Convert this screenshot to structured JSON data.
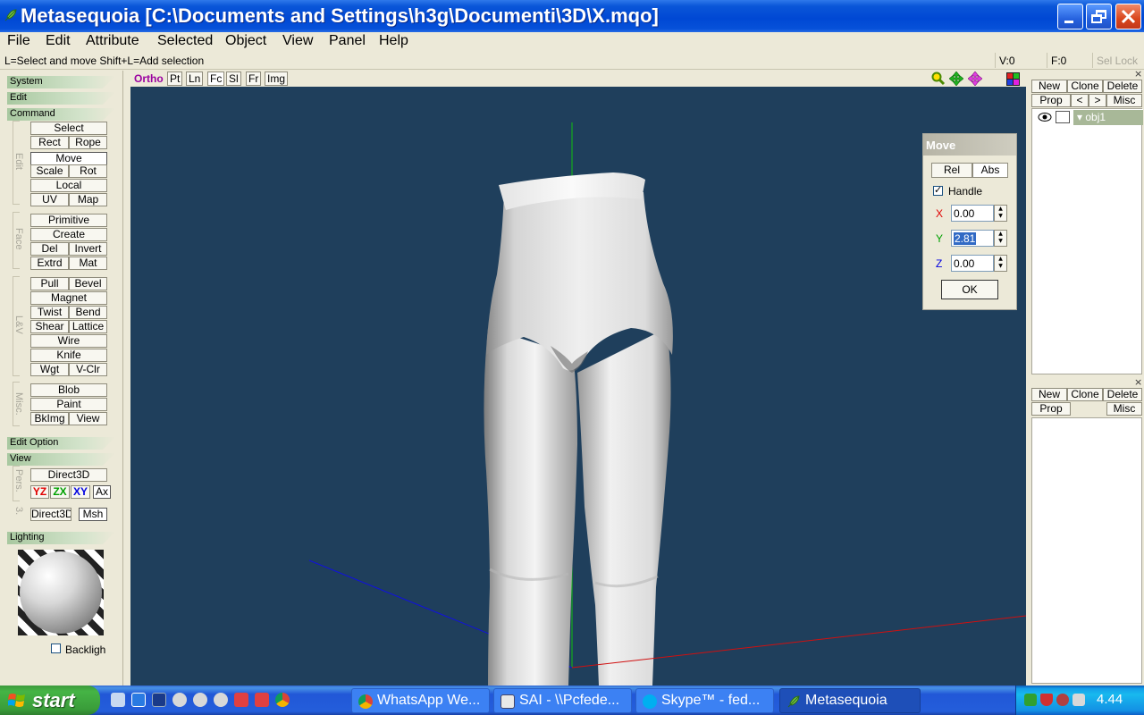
{
  "window": {
    "title": "Metasequoia [C:\\Documents and Settings\\h3g\\Documenti\\3D\\X.mqo]"
  },
  "menu": [
    "File",
    "Edit",
    "Attribute",
    "Selected",
    "Object",
    "View",
    "Panel",
    "Help"
  ],
  "status": {
    "hint": "L=Select and move  Shift+L=Add selection",
    "vertices": "V:0",
    "faces": "F:0",
    "sel_lock": "Sel Lock"
  },
  "left_panel": {
    "sections": [
      "System",
      "Edit",
      "Command",
      "Edit Option",
      "View",
      "Lighting"
    ],
    "group_labels": [
      "Edit",
      "Face",
      "L&V",
      "Misc.",
      "Pers.",
      "3."
    ],
    "edit_buttons": [
      "Select",
      "Rect",
      "Rope",
      "Move",
      "Scale",
      "Rot",
      "Local",
      "UV",
      "Map"
    ],
    "face_buttons": [
      "Primitive",
      "Create",
      "Del",
      "Invert",
      "Extrd",
      "Mat"
    ],
    "lv_buttons": [
      "Pull",
      "Bevel",
      "Magnet",
      "Twist",
      "Bend",
      "Shear",
      "Lattice",
      "Wire",
      "Knife",
      "Wgt",
      "V-Clr"
    ],
    "misc_buttons": [
      "Blob",
      "Paint",
      "BkImg",
      "View"
    ],
    "view_buttons": [
      "Direct3D",
      "YZ",
      "ZX",
      "XY",
      "Ax",
      "Direct3D",
      "Msh"
    ],
    "backlight_label": "Backligh"
  },
  "viewport_toolbar": {
    "mode": "Ortho",
    "buttons": [
      "Pt",
      "Ln",
      "Fc",
      "Sl",
      "Fr",
      "Img"
    ]
  },
  "move_dialog": {
    "title": "Move",
    "tabs": [
      "Rel",
      "Abs"
    ],
    "handle_label": "Handle",
    "handle_checked": true,
    "x_label": "X",
    "x_value": "0.00",
    "y_label": "Y",
    "y_value": "2.81",
    "z_label": "Z",
    "z_value": "0.00",
    "ok_label": "OK"
  },
  "right_panel": {
    "object_buttons": [
      "New",
      "Clone",
      "Delete",
      "Prop",
      "<",
      ">",
      "Misc"
    ],
    "object_name": "obj1",
    "material_buttons": [
      "New",
      "Clone",
      "Delete",
      "Prop",
      "Misc"
    ]
  },
  "taskbar": {
    "start_label": "start",
    "tasks": [
      "WhatsApp We...",
      "SAI - \\\\Pcfede...",
      "Skype™ - fed...",
      "Metasequoia"
    ],
    "clock": "4.44"
  },
  "colors": {
    "viewport_bg": "#1f3f5c",
    "axis_x": "#d01010",
    "axis_y": "#10c010",
    "axis_z": "#1010e0"
  }
}
